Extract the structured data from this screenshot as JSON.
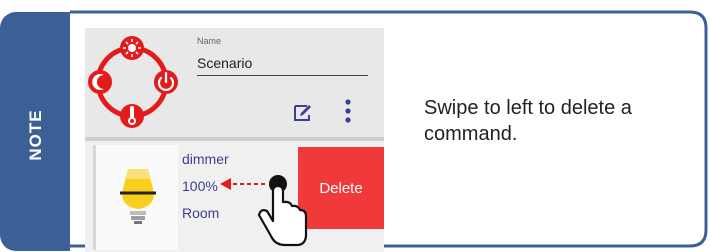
{
  "note": {
    "label": "NOTE",
    "accent_color": "#3c5f96"
  },
  "header": {
    "name_label": "Name",
    "name_value": "Scenario"
  },
  "icons": {
    "logo": "scenario-logo",
    "edit": "edit-icon",
    "menu": "more-vert-icon"
  },
  "command": {
    "name": "dimmer",
    "value": "100%",
    "location": "Room",
    "delete_label": "Delete",
    "delete_color": "#f03a3a"
  },
  "hint": "Swipe to left to delete a command."
}
